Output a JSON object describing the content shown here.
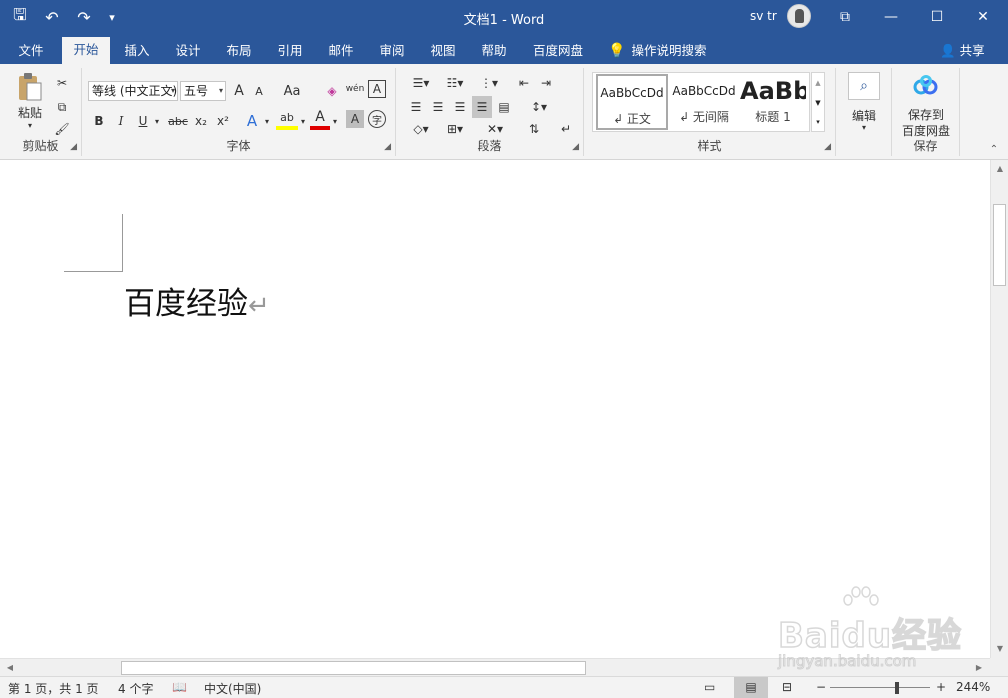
{
  "window": {
    "title": "文档1  -  Word",
    "user": "sv tr",
    "minimize_glyph": "—",
    "restore_glyph": "☐",
    "close_glyph": "✕",
    "ribbon_display_glyph": "⧉"
  },
  "qat": {
    "save_glyph": "🖫",
    "undo_glyph": "↶",
    "redo_glyph": "↷",
    "customize_glyph": "▾"
  },
  "tabs": [
    {
      "label": "文件"
    },
    {
      "label": "开始"
    },
    {
      "label": "插入"
    },
    {
      "label": "设计"
    },
    {
      "label": "布局"
    },
    {
      "label": "引用"
    },
    {
      "label": "邮件"
    },
    {
      "label": "审阅"
    },
    {
      "label": "视图"
    },
    {
      "label": "帮助"
    },
    {
      "label": "百度网盘"
    }
  ],
  "tell_me": {
    "label": "操作说明搜索"
  },
  "share": {
    "label": "共享"
  },
  "ribbon": {
    "clipboard": {
      "label": "剪贴板",
      "paste_label": "粘贴"
    },
    "font": {
      "label": "字体",
      "font_name": "等线 (中文正文)",
      "font_size": "五号",
      "grow": "A",
      "shrink": "A",
      "case": "Aa",
      "bold": "B",
      "italic": "I",
      "underline": "U",
      "strike": "abc",
      "sub": "x₂",
      "sup": "x²",
      "effects": "A",
      "highlight": "ab",
      "color": "A",
      "shade": "A",
      "pinyin": "wén",
      "border": "A",
      "enclose": "字"
    },
    "paragraph": {
      "label": "段落"
    },
    "styles": {
      "label": "样式",
      "items": [
        {
          "preview": "AaBbCcDd",
          "name": "↲ 正文"
        },
        {
          "preview": "AaBbCcDd",
          "name": "↲ 无间隔"
        },
        {
          "preview": "AaBb",
          "name": "标题 1"
        }
      ]
    },
    "editing": {
      "label": "编辑"
    },
    "save": {
      "label": "保存",
      "button_line1": "保存到",
      "button_line2": "百度网盘"
    }
  },
  "document": {
    "text": "百度经验",
    "pilcrow": "↵"
  },
  "statusbar": {
    "page": "第 1 页，共 1 页",
    "words": "4 个字",
    "language": "中文(中国)",
    "zoom": "244%",
    "zoom_minus": "−",
    "zoom_plus": "+"
  },
  "watermark": {
    "brand": "Baidu经验",
    "url": "jingyan.baidu.com"
  },
  "colors": {
    "brand_blue": "#2b579a",
    "ribbon_bg": "#f3f3f3",
    "font_color_underline": "#e00000",
    "highlight_yellow": "#ffff00"
  }
}
